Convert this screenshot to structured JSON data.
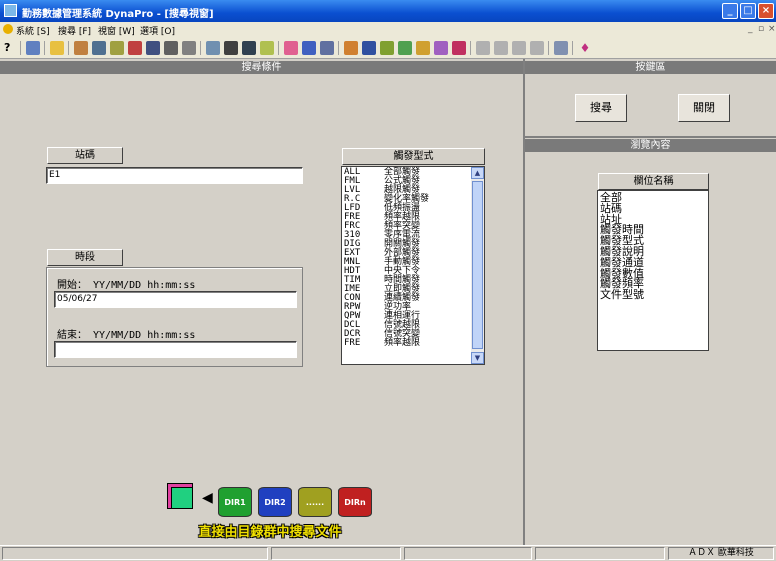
{
  "window": {
    "title": "勤務數據管理系統 DynaPro - [搜尋視窗]"
  },
  "menu": {
    "items": [
      "系統 [S]",
      "搜尋 [F]",
      "視窗 [W]",
      "選項 [O]"
    ]
  },
  "left_panel": {
    "header": "搜尋條件",
    "station": {
      "label": "站碼",
      "value": "E1"
    },
    "period": {
      "label": "時段",
      "start_label": "開始： YY/MM/DD hh:mm:ss",
      "start_value": "05/06/27",
      "end_label": "結束： YY/MM/DD hh:mm:ss",
      "end_value": ""
    },
    "trigger_type": {
      "label": "觸發型式",
      "items": [
        {
          "code": "ALL",
          "text": "全部觸發"
        },
        {
          "code": "FML",
          "text": "公式觸發"
        },
        {
          "code": "LVL",
          "text": "越限觸發"
        },
        {
          "code": "R.C",
          "text": "變化率觸發"
        },
        {
          "code": "LFD",
          "text": "低頻振盪"
        },
        {
          "code": "FRE",
          "text": "頻率越限"
        },
        {
          "code": "FRC",
          "text": "頻率突變"
        },
        {
          "code": "310",
          "text": "零序電流"
        },
        {
          "code": "DIG",
          "text": "開關觸發"
        },
        {
          "code": "EXT",
          "text": "外部觸發"
        },
        {
          "code": "MNL",
          "text": "手動觸發"
        },
        {
          "code": "HDT",
          "text": "中央下令"
        },
        {
          "code": "TIM",
          "text": "時間觸發"
        },
        {
          "code": "IME",
          "text": "立即觸發"
        },
        {
          "code": "CON",
          "text": "連續觸發"
        },
        {
          "code": "RPW",
          "text": "逆功率"
        },
        {
          "code": "QPW",
          "text": "連相運行"
        },
        {
          "code": "DCL",
          "text": "信號越限"
        },
        {
          "code": "DCR",
          "text": "信號突變"
        },
        {
          "code": "FRE",
          "text": "頻率越限"
        }
      ]
    },
    "dir_search": {
      "drums": [
        "DIR1",
        "DIR2",
        "......",
        "DIRn"
      ],
      "caption": "直接由目錄群中搜尋文件"
    }
  },
  "right_panel": {
    "header": "按鍵區",
    "search_button": "搜尋",
    "close_button": "關閉",
    "browse_header": "瀏覽內容",
    "field_list": {
      "label": "欄位名稱",
      "items": [
        "全部",
        "站碼",
        "站址",
        "觸發時間",
        "觸發型式",
        "觸發說明",
        "觸發通道",
        "觸發數值",
        "觸發頻率",
        "文件型號"
      ]
    }
  },
  "status": {
    "company": "ＡＤＸ 歐華科技"
  }
}
